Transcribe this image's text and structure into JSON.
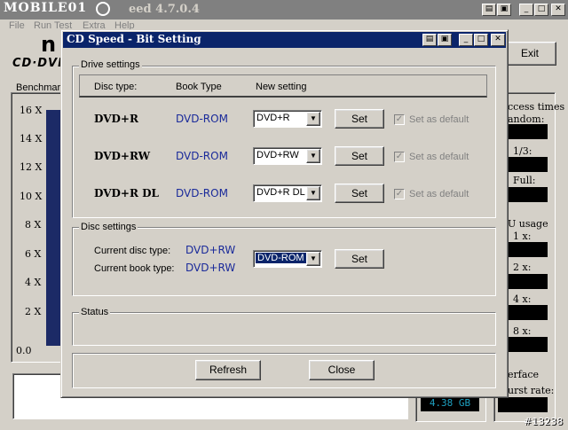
{
  "main_window": {
    "title": "MOBILE01",
    "title_version": "eed 4.7.0.4",
    "menu": [
      "File",
      "Run Test",
      "Extra",
      "Help"
    ],
    "logo_char": "n",
    "logo_text": "CD·DVD",
    "benchmark_label": "Benchmark",
    "exit_label": "Exit",
    "y_ticks": [
      "16 X",
      "14 X",
      "12 X",
      "10 X",
      "8 X",
      "6 X",
      "4 X",
      "2 X",
      "0.0"
    ],
    "right_panel": {
      "access_times": "ccess times",
      "random": "andom:",
      "one_third": "1/3:",
      "full": "Full:",
      "cpu_usage": "U usage",
      "x1": "1 x:",
      "x2": "2 x:",
      "x4": "4 x:",
      "x8": "8 x:",
      "interface": "erface",
      "burst_rate": "urst rate:"
    },
    "capacity": "4.38 GB",
    "watermark": "#13238"
  },
  "dialog": {
    "title": "CD Speed - Bit Setting",
    "drive_settings_label": "Drive settings",
    "headers": {
      "disc_type": "Disc type:",
      "book_type": "Book Type",
      "new_setting": "New setting"
    },
    "rows": [
      {
        "disc": "DVD+R",
        "book": "DVD-ROM",
        "setting": "DVD+R",
        "set_label": "Set",
        "default_label": "Set as default"
      },
      {
        "disc": "DVD+RW",
        "book": "DVD-ROM",
        "setting": "DVD+RW",
        "set_label": "Set",
        "default_label": "Set as default"
      },
      {
        "disc": "DVD+R DL",
        "book": "DVD-ROM",
        "setting": "DVD+R DL",
        "set_label": "Set",
        "default_label": "Set as default"
      }
    ],
    "disc_settings_label": "Disc settings",
    "current_disc_type_label": "Current disc type:",
    "current_disc_type": "DVD+RW",
    "current_book_type_label": "Current book type:",
    "current_book_type": "DVD+RW",
    "disc_setting_value": "DVD-ROM",
    "disc_set_label": "Set",
    "status_label": "Status",
    "refresh_label": "Refresh",
    "close_label": "Close"
  },
  "colors": {
    "dialog_title_bar": "#0a246a",
    "book_type_text": "#1a2a9a",
    "face": "#d4d0c8"
  }
}
